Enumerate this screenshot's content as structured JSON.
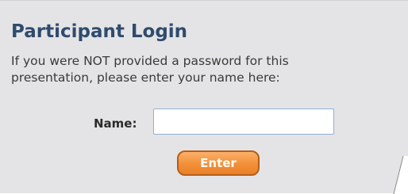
{
  "login": {
    "title": "Participant Login",
    "instruction_line1": "If you were NOT provided a password for this",
    "instruction_line2": "presentation, please enter your name here:",
    "name_label": "Name:",
    "name_value": "",
    "enter_label": "Enter"
  },
  "colors": {
    "title": "#2f4b6e",
    "panel_background": "#e4e4e6",
    "button": "#f29038",
    "button_border": "#b55e18"
  }
}
